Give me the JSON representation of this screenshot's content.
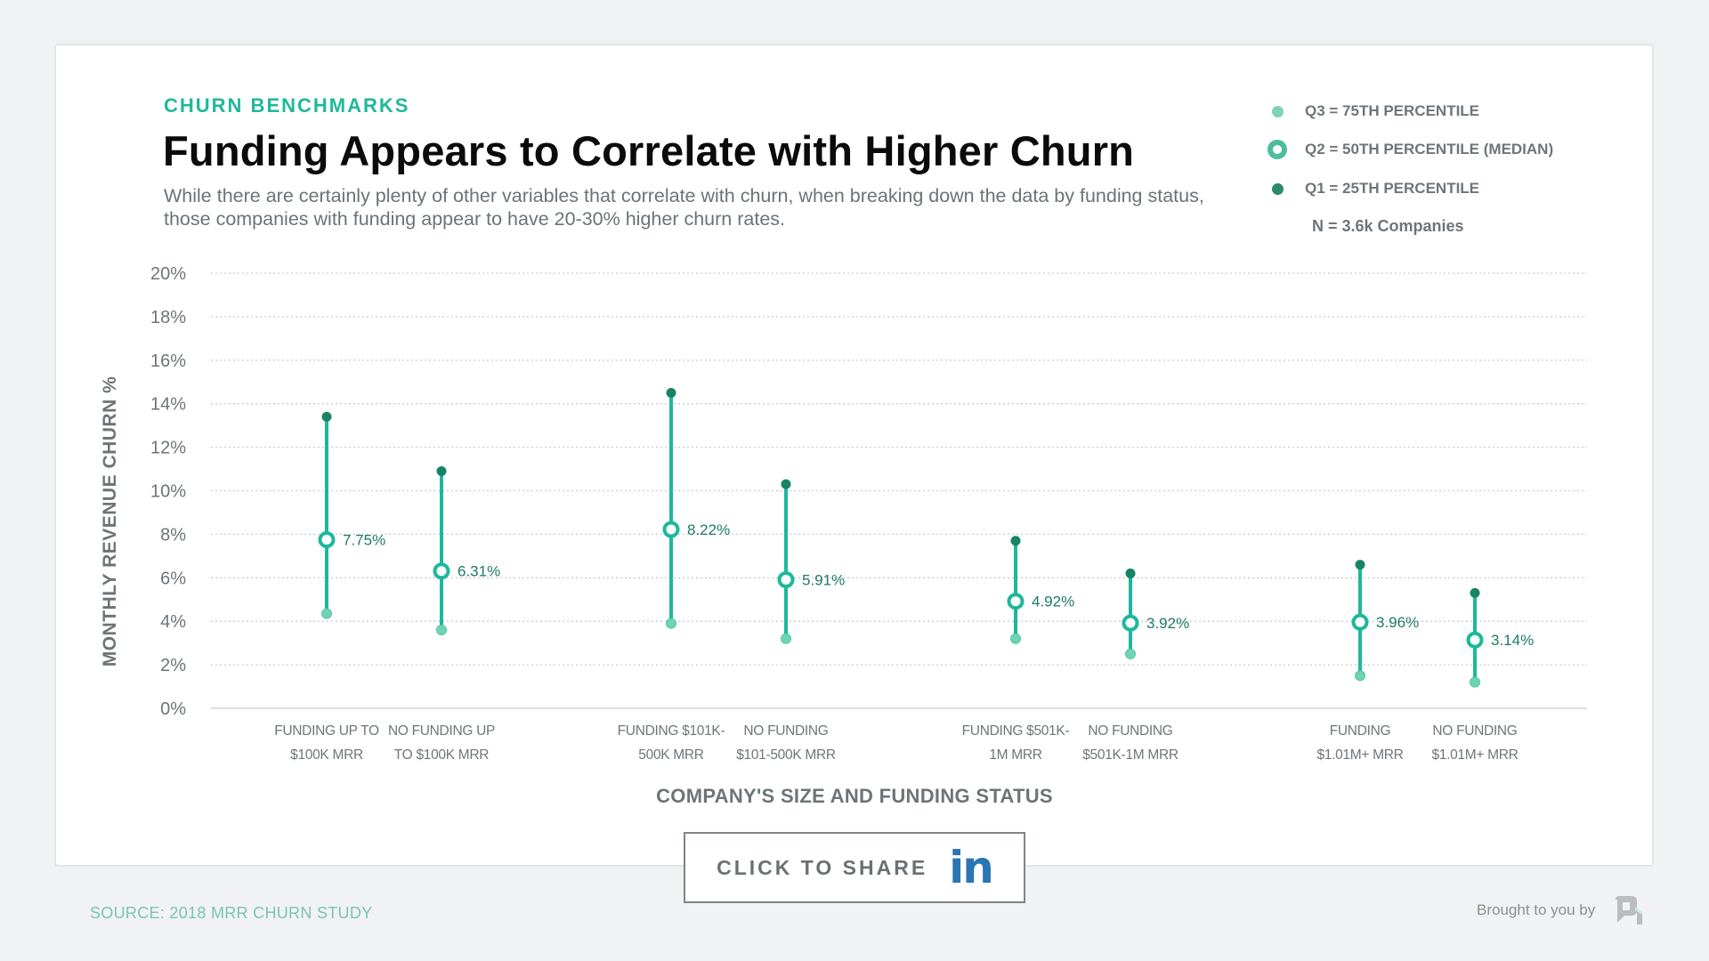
{
  "header": {
    "eyebrow": "CHURN BENCHMARKS",
    "title": "Funding Appears to Correlate with Higher Churn",
    "subtitle": "While there are certainly plenty of other variables that correlate with churn, when breaking down the data by funding status, those companies with funding appear to have 20-30% higher churn rates."
  },
  "legend": {
    "items": [
      {
        "label": "Q3 = 75TH PERCENTILE",
        "marker": "small-light-dot",
        "color": "#7fd3b9"
      },
      {
        "label": "Q2 = 50TH PERCENTILE (MEDIAN)",
        "marker": "ring",
        "color": "#4dbc9c"
      },
      {
        "label": "Q1  = 25TH PERCENTILE",
        "marker": "small-dark-dot",
        "color": "#2e8a6e"
      }
    ],
    "n_label": "N = 3.6k Companies"
  },
  "colors": {
    "accent": "#1fb89a",
    "line": "#1db89b",
    "top_dot": "#178466",
    "bottom_dot": "#6fd4b6",
    "median_label": "#1f7a66",
    "grid": "#c9cdd0",
    "axis_text": "#6d7478"
  },
  "chart_data": {
    "type": "range-dot",
    "title": "Funding Appears to Correlate with Higher Churn",
    "xlabel": "COMPANY'S SIZE AND FUNDING STATUS",
    "ylabel": "MONTHLY REVENUE CHURN %",
    "ylim": [
      0,
      20
    ],
    "yticks": [
      0,
      2,
      4,
      6,
      8,
      10,
      12,
      14,
      16,
      18,
      20
    ],
    "ytick_labels": [
      "0%",
      "2%",
      "4%",
      "6%",
      "8%",
      "10%",
      "12%",
      "14%",
      "16%",
      "18%",
      "20%"
    ],
    "grid": true,
    "grid_style": "dotted horizontal",
    "legend_position": "top-right",
    "categories": [
      [
        "FUNDING UP TO",
        "$100K MRR"
      ],
      [
        "NO FUNDING UP",
        "TO $100K MRR"
      ],
      [
        "FUNDING  $101K-",
        "500K MRR"
      ],
      [
        "NO FUNDING",
        "$101-500K MRR"
      ],
      [
        "FUNDING  $501K-",
        "1M MRR"
      ],
      [
        "NO FUNDING",
        "$501K-1M MRR"
      ],
      [
        "FUNDING",
        "$1.01M+ MRR"
      ],
      [
        "NO FUNDING",
        "$1.01M+ MRR"
      ]
    ],
    "groups": [
      [
        0,
        1
      ],
      [
        2,
        3
      ],
      [
        4,
        5
      ],
      [
        6,
        7
      ]
    ],
    "series": [
      {
        "name": "Upper (dark dot)",
        "values": [
          13.4,
          10.9,
          14.5,
          10.3,
          7.7,
          6.2,
          6.6,
          5.3
        ]
      },
      {
        "name": "Median",
        "values": [
          7.75,
          6.31,
          8.22,
          5.91,
          4.92,
          3.92,
          3.96,
          3.14
        ]
      },
      {
        "name": "Lower (light dot)",
        "values": [
          4.35,
          3.6,
          3.9,
          3.2,
          3.2,
          2.5,
          1.5,
          1.2
        ]
      }
    ],
    "median_labels": [
      "7.75%",
      "6.31%",
      "8.22%",
      "5.91%",
      "4.92%",
      "3.92%",
      "3.96%",
      "3.14%"
    ]
  },
  "share": {
    "label": "CLICK TO SHARE",
    "icon_text": "in"
  },
  "footer": {
    "source": "SOURCE: 2018 MRR CHURN STUDY",
    "brought_by": "Brought to you by"
  }
}
